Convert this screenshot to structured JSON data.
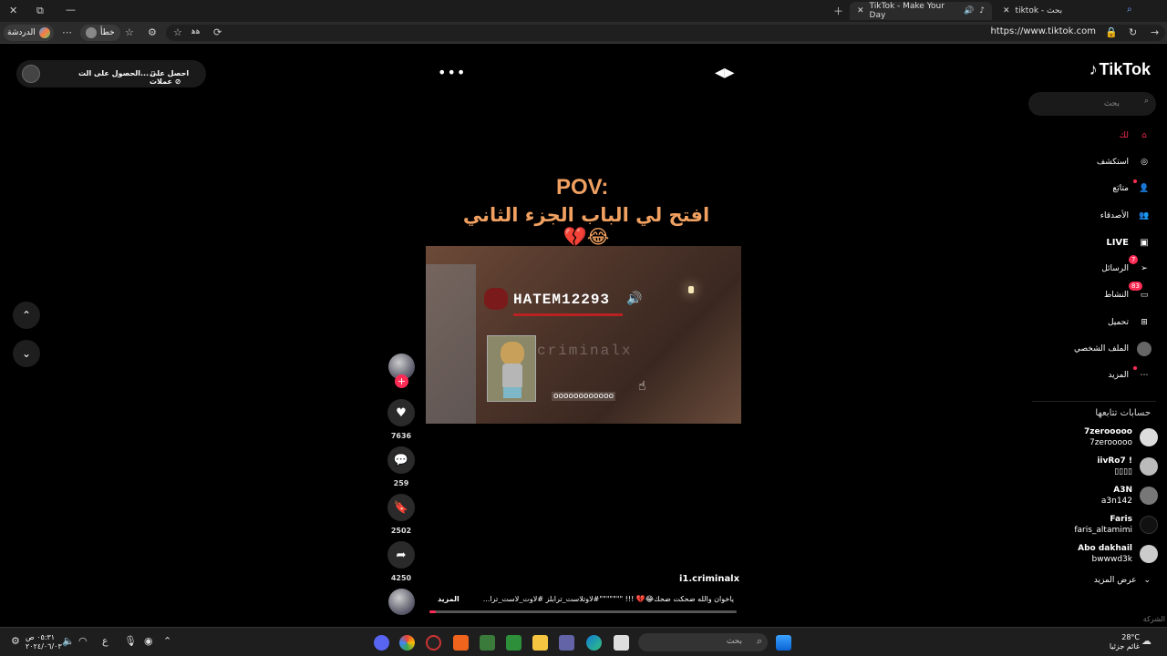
{
  "browser": {
    "tabs": [
      {
        "label": "tiktok - بحث"
      },
      {
        "label": "TikTok - Make Your Day"
      }
    ],
    "url": "https://www.tiktok.com",
    "profile_label": "خطأ",
    "chat_label": "الدردشة",
    "translate_label": "ﻫﻫ"
  },
  "sidebar": {
    "logo": "TikTok",
    "search_placeholder": "بحث",
    "nav": [
      {
        "label": "لك",
        "icon": "home-icon"
      },
      {
        "label": "استكشف",
        "icon": "compass-icon"
      },
      {
        "label": "متابَع",
        "icon": "following-icon"
      },
      {
        "label": "الأصدقاء",
        "icon": "friends-icon"
      },
      {
        "label": "LIVE",
        "icon": "live-icon"
      },
      {
        "label": "الرسائل",
        "icon": "messages-icon",
        "badge": "7"
      },
      {
        "label": "النشاط",
        "icon": "activity-icon",
        "badge": "83"
      },
      {
        "label": "تحميل",
        "icon": "upload-icon"
      },
      {
        "label": "الملف الشخصي",
        "icon": "profile-icon"
      },
      {
        "label": "المزيد",
        "icon": "more-icon"
      }
    ],
    "following_heading": "حسابات تتابعها",
    "accounts": [
      {
        "name": "7zerooooo",
        "handle": "7zerooooo"
      },
      {
        "name": "iivRo7 !",
        "handle": "▯▯▯▯"
      },
      {
        "name": "A3N",
        "handle": "a3n142"
      },
      {
        "name": "Faris",
        "handle": "faris_altamimi"
      },
      {
        "name": "Abo dakhail",
        "handle": "bwwwd3k"
      }
    ],
    "see_more": "عرض المزيد",
    "footer": "الشركة"
  },
  "topbar": {
    "coins_label": "احصل على عملات",
    "app_label": "الحصول على الت..."
  },
  "video": {
    "pov": "POV:",
    "caption": "افتح لي الباب الجزء الثاني😂💔",
    "player_name": "HATEM12293",
    "watermark": "criminalx",
    "subtitle": "oooooooooooo",
    "author": "i1.criminalx",
    "description": "ياخوان والله ضحكت ضحك😂💔 !!! \"\"\"\"\"\"\"#لاوتلاست_ترابلز #لاوت_لاست_ترا...",
    "description_more": "المزيد",
    "progress": 0.02,
    "likes": "7636",
    "comments": "259",
    "saves": "2502",
    "shares": "4250"
  },
  "taskbar": {
    "search_placeholder": "بحث",
    "time": "٠٥:٣١ ص",
    "date": "٢٠٢٤/٠٦/٠٣",
    "weather_temp": "28°C",
    "weather_desc": "غائم جزئيا",
    "lang": "ع"
  },
  "colors": {
    "accent": "#fe2c55",
    "caption": "#f0a060"
  }
}
